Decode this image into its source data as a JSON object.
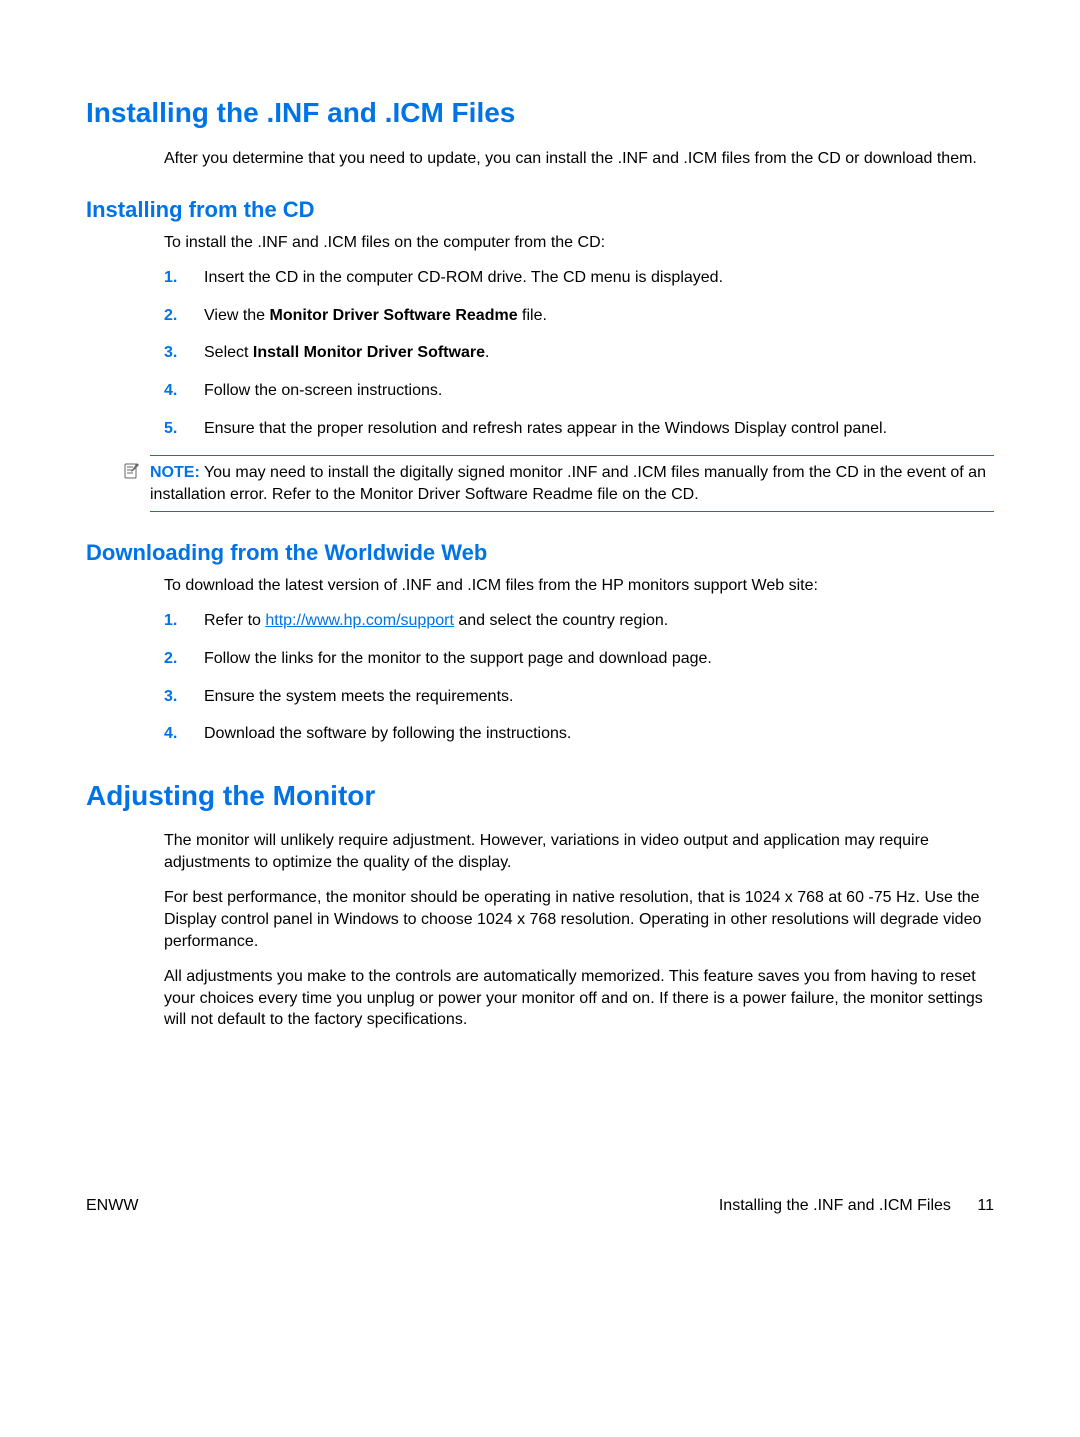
{
  "h1a": "Installing the .INF and .ICM Files",
  "p_after_h1a": "After you determine that you need to update, you can install the .INF and .ICM files from the CD or download them.",
  "h2a": "Installing from the CD",
  "p_install_cd_intro": "To install the .INF and .ICM files on the computer from the CD:",
  "list_cd": {
    "n1": "1.",
    "t1": "Insert the CD in the computer CD-ROM drive. The CD menu is displayed.",
    "n2": "2.",
    "t2_pre": "View the ",
    "t2_bold": "Monitor Driver Software Readme",
    "t2_post": " file.",
    "n3": "3.",
    "t3_pre": "Select ",
    "t3_bold": "Install Monitor Driver Software",
    "t3_post": ".",
    "n4": "4.",
    "t4": "Follow the on-screen instructions.",
    "n5": "5.",
    "t5": "Ensure that the proper resolution and refresh rates appear in the Windows Display control panel."
  },
  "note": {
    "label": "NOTE:",
    "text": "   You may need to install the digitally signed monitor .INF and .ICM files manually from the CD in the event of an installation error. Refer to the Monitor Driver Software Readme file on the CD."
  },
  "h2b": "Downloading from the Worldwide Web",
  "p_download_intro": "To download the latest version of .INF and .ICM files from the HP monitors support Web site:",
  "list_web": {
    "n1": "1.",
    "t1_pre": "Refer to ",
    "t1_link": "http://www.hp.com/support",
    "t1_post": " and select the country region.",
    "n2": "2.",
    "t2": "Follow the links for the monitor to the support page and download page.",
    "n3": "3.",
    "t3": "Ensure the system meets the requirements.",
    "n4": "4.",
    "t4": "Download the software by following the instructions."
  },
  "h1b": "Adjusting the Monitor",
  "p_adj1": "The monitor will unlikely require adjustment. However, variations in video output and application may require adjustments to optimize the quality of the display.",
  "p_adj2": "For best performance, the monitor should be operating in native resolution, that is 1024 x 768 at 60 -75 Hz. Use the Display control panel in Windows to choose 1024 x 768 resolution. Operating in other resolutions will degrade video performance.",
  "p_adj3": "All adjustments you make to the controls are automatically memorized. This feature saves you from having to reset your choices every time you unplug or power your monitor off and on. If there is a power failure, the monitor settings will not default to the factory specifications.",
  "footer": {
    "left": "ENWW",
    "right_text": "Installing the .INF and .ICM Files",
    "page_num": "11"
  },
  "note_icon_glyph": "✎"
}
